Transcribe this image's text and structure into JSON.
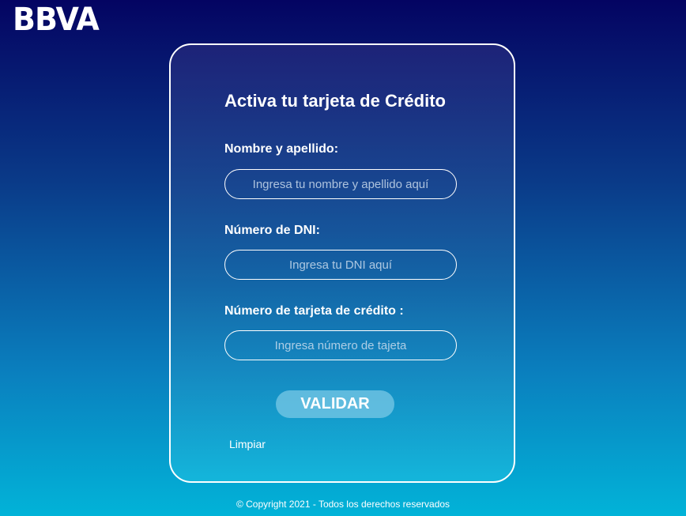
{
  "brand": {
    "logo_text": "BBVA"
  },
  "form": {
    "title": "Activa tu tarjeta de Crédito",
    "fields": [
      {
        "label": "Nombre y apellido:",
        "placeholder": "Ingresa tu nombre y apellido aquí",
        "value": ""
      },
      {
        "label": "Número de DNI:",
        "placeholder": "Ingresa tu DNI aquí",
        "value": ""
      },
      {
        "label": "Número de tarjeta de crédito :",
        "placeholder": "Ingresa número de tajeta",
        "value": ""
      }
    ],
    "submit_label": "VALIDAR",
    "clear_label": "Limpiar"
  },
  "footer": {
    "copyright": "© Copyright 2021 - Todos los derechos reservados"
  },
  "colors": {
    "background_top": "#040462",
    "background_bottom": "#02b3d8",
    "button_bg": "#78c8e6",
    "text": "#ffffff"
  }
}
